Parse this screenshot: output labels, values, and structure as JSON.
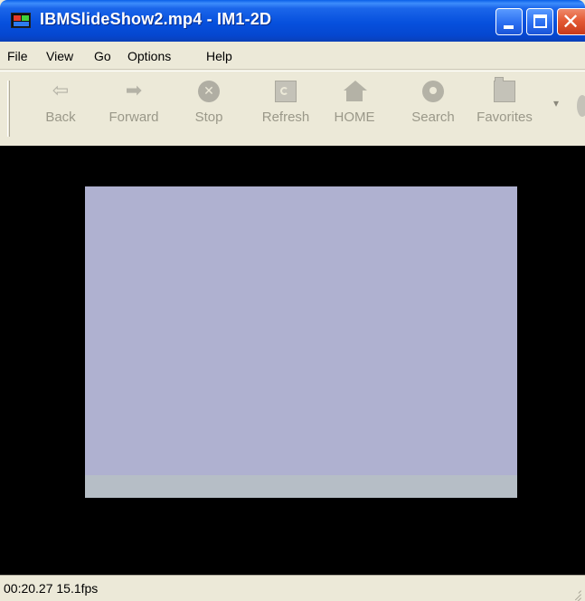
{
  "window": {
    "title": "IBMSlideShow2.mp4 - IM1-2D",
    "close_glyph": "✕"
  },
  "menu": [
    "File",
    "View",
    "Go",
    "Options",
    "Help"
  ],
  "toolbar": {
    "back": "Back",
    "forward": "Forward",
    "stop": "Stop",
    "refresh": "Refresh",
    "home": "HOME",
    "search": "Search",
    "favorites": "Favorites",
    "back_glyph": "⇦",
    "forward_glyph": "➡",
    "stop_glyph": "✕",
    "overflow_glyph": "▾"
  },
  "video": {
    "frame_color": "#afb1d0",
    "strip_color": "#b6bec6"
  },
  "status": {
    "text": "00:20.27 15.1fps"
  }
}
